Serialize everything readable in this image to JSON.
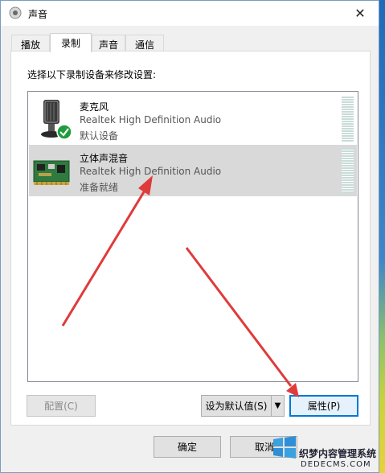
{
  "window": {
    "title": "声音",
    "close_label": "✕"
  },
  "tabs": [
    {
      "label": "播放",
      "active": false
    },
    {
      "label": "录制",
      "active": true
    },
    {
      "label": "声音",
      "active": false
    },
    {
      "label": "通信",
      "active": false
    }
  ],
  "panel": {
    "instruction": "选择以下录制设备来修改设置:"
  },
  "devices": [
    {
      "name": "麦克风",
      "driver": "Realtek High Definition Audio",
      "status": "默认设备",
      "icon": "microphone-icon",
      "selected": false
    },
    {
      "name": "立体声混音",
      "driver": "Realtek High Definition Audio",
      "status": "准备就绪",
      "icon": "sound-card-icon",
      "selected": true
    }
  ],
  "buttons": {
    "configure": "配置(C)",
    "set_default": "设为默认值(S)",
    "set_default_arrow": "▼",
    "properties": "属性(P)",
    "ok": "确定",
    "cancel": "取消"
  },
  "watermark": {
    "line1": "织梦内容管理系统",
    "line2": "DEDECMS.COM"
  },
  "colors": {
    "annotation_arrow": "#e03a3a",
    "focus_border": "#0078d7",
    "selected_row": "#d9d9d9"
  }
}
